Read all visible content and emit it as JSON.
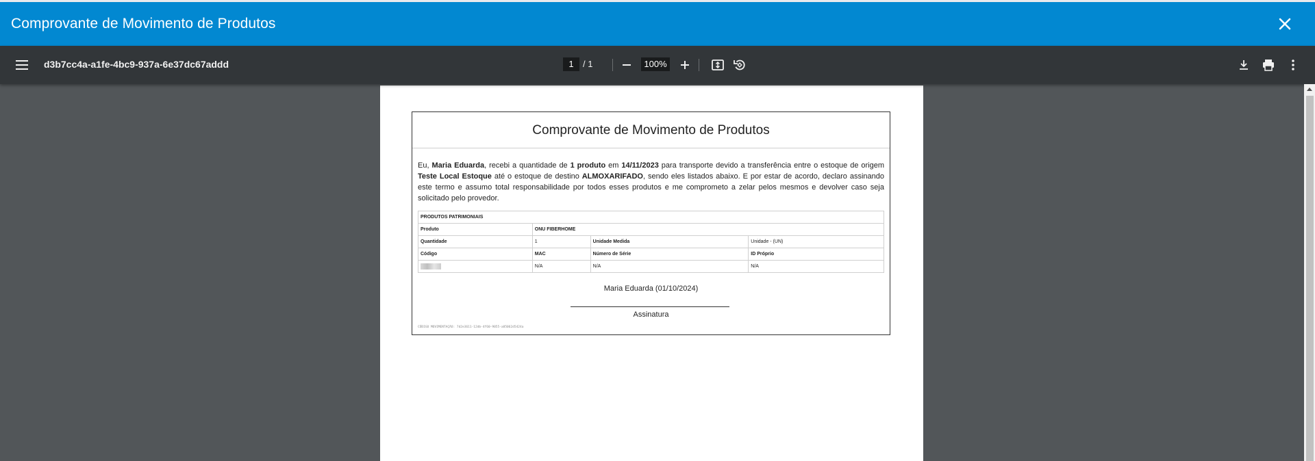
{
  "dialog": {
    "title": "Comprovante de Movimento de Produtos",
    "close_icon": "close-icon"
  },
  "toolbar": {
    "menu_icon": "menu-icon",
    "document_name": "d3b7cc4a-a1fe-4bc9-937a-6e37dc67addd",
    "page_current": "1",
    "page_total": "/ 1",
    "zoom": "100%",
    "icons": [
      "zoom-out-icon",
      "zoom-in-icon",
      "fit-page-icon",
      "rotate-icon",
      "download-icon",
      "print-icon",
      "more-vert-icon"
    ]
  },
  "document": {
    "heading": "Comprovante de Movimento de Produtos",
    "paragraph": {
      "p1": "Eu, ",
      "name": "Maria Eduarda",
      "p2": ", recebi a quantidade de ",
      "qty": "1 produto",
      "p3": " em ",
      "date": "14/11/2023",
      "p4": " para transporte devido a transferência entre o estoque de origem ",
      "origin": "Teste Local Estoque",
      "p5": " até o estoque de destino ",
      "destination": "ALMOXARIFADO",
      "p6": ", sendo eles listados abaixo. E por estar de acordo, declaro assinando este termo e assumo total responsabilidade por todos esses produtos e me comprometo a zelar pelos mesmos e devolver caso seja solicitado pelo provedor."
    },
    "table": {
      "section_header": "PRODUTOS PATRIMONIAIS",
      "produto_label": "Produto",
      "produto_value": "ONU FIBERHOME",
      "quantidade_label": "Quantidade",
      "quantidade_value": "1",
      "unidade_label": "Unidade Medida",
      "unidade_value": "Unidade - (UN)",
      "codigo_label": "Código",
      "mac_label": "MAC",
      "serie_label": "Número de Série",
      "id_label": "ID Próprio",
      "mac_value": "N/A",
      "serie_value": "N/A",
      "id_value": "N/A"
    },
    "signer": "Maria Eduarda (01/10/2024)",
    "signature_label": "Assinatura",
    "footer_code": "CÓDIGO MOVIMENTAÇÃO: 7d2e3611-12db-4f60-9055-a85062d5424a"
  }
}
